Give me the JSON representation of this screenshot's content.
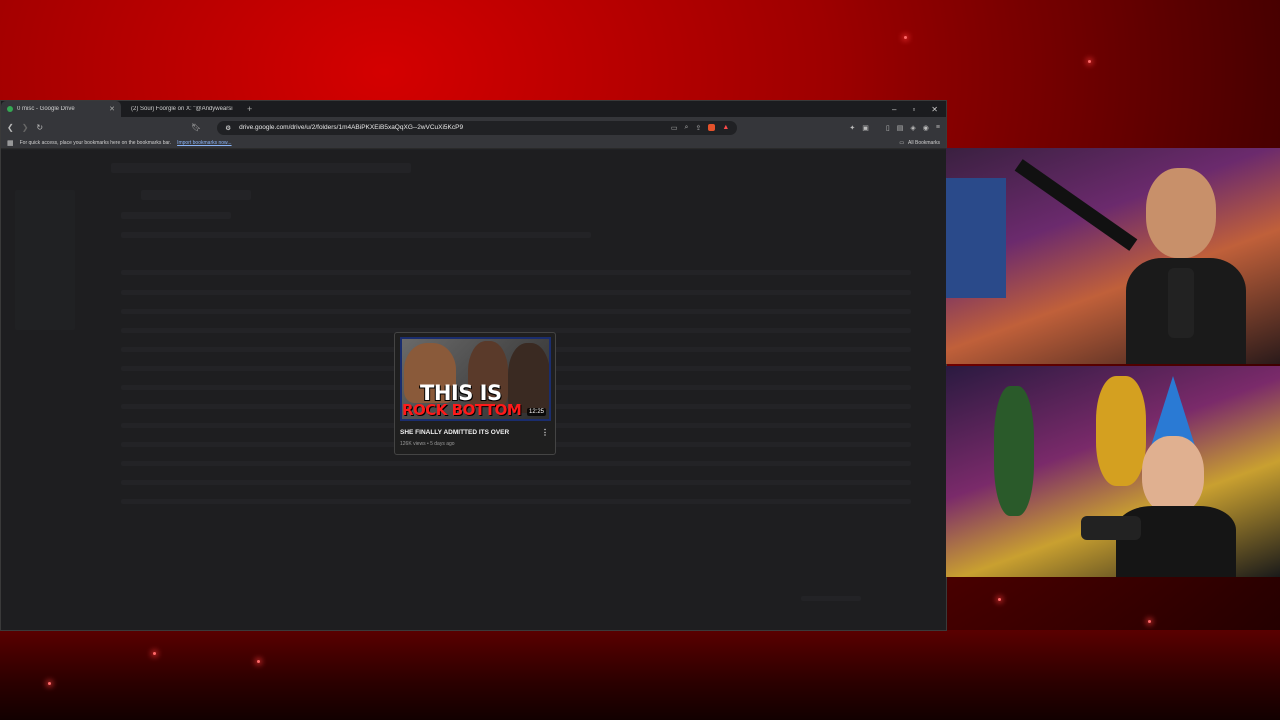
{
  "browser": {
    "tabs": [
      {
        "label": "0 misc - Google Drive",
        "favicon_color": "#34a853",
        "active": true
      },
      {
        "label": "(2) Sourj Foorgle on X: \"@Andywearsi",
        "favicon_color": "#ffffff",
        "active": false
      }
    ],
    "new_tab_symbol": "+",
    "window_controls": [
      "–",
      "▫",
      "✕"
    ],
    "url": "drive.google.com/drive/u/2/folders/1m4ABiPKXEiB5xaQqXG--2wVCuXi5KcP9",
    "bookmarks_bar": {
      "prompt": "For quick access, place your bookmarks here on the bookmarks bar.",
      "import_link": "Import bookmarks now...",
      "all_bookmarks": "All Bookmarks"
    }
  },
  "video_card": {
    "title": "SHE FINALLY ADMITTED ITS OVER",
    "meta": "126K views • 5 days ago",
    "duration": "12:25",
    "thumb_line1": "THIS IS",
    "thumb_line2": "ROCK BOTTOM"
  },
  "colors": {
    "accent_red": "#d40000",
    "thumb_text_red": "#ff1a1a",
    "link_blue": "#8ab4f8"
  }
}
